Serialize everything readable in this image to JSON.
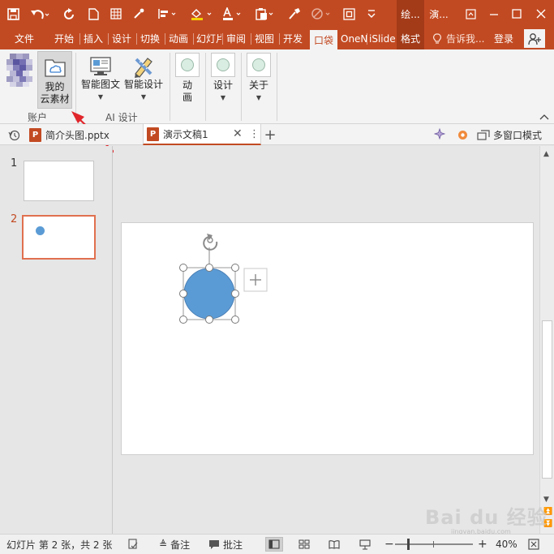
{
  "title_bar": {
    "context_tab_1": "绘...",
    "context_tab_2": "演...",
    "window_buttons": [
      "restore",
      "minimize",
      "maximize",
      "close"
    ]
  },
  "tabs": [
    {
      "label": "文件"
    },
    {
      "label": "开始"
    },
    {
      "label": "插入"
    },
    {
      "label": "设计"
    },
    {
      "label": "切换"
    },
    {
      "label": "动画"
    },
    {
      "label": "幻灯片"
    },
    {
      "label": "审阅"
    },
    {
      "label": "视图"
    },
    {
      "label": "开发"
    },
    {
      "label": "口袋",
      "active": true
    },
    {
      "label": "OneN"
    },
    {
      "label": "iSlide"
    },
    {
      "label": "格式"
    }
  ],
  "tell_me": "告诉我...",
  "login": "登录",
  "ribbon": {
    "account": {
      "my_assets": "我的\n云素材",
      "group_label": "账户"
    },
    "ai_design": {
      "smart_graphic": "智能图文",
      "smart_design": "智能设计",
      "group_label": "AI 设计"
    },
    "animate": "动\n画",
    "design": "设计",
    "about": "关于"
  },
  "doc_tabs": {
    "tab1": "简介头图.pptx",
    "tab2": "演示文稿1",
    "multi_window": "多窗口模式"
  },
  "slides": {
    "numbers": [
      "1",
      "2"
    ]
  },
  "status_bar": {
    "slide_info": "幻灯片 第 2 张，共 2 张",
    "notes": "备注",
    "comments": "批注",
    "zoom": "40%"
  },
  "watermark": {
    "logo": "Bai du 经验",
    "url": "jingyan.baidu.com"
  },
  "colors": {
    "accent": "#c24a22",
    "shape_fill": "#5b9bd5",
    "arrow": "#e0262b"
  }
}
